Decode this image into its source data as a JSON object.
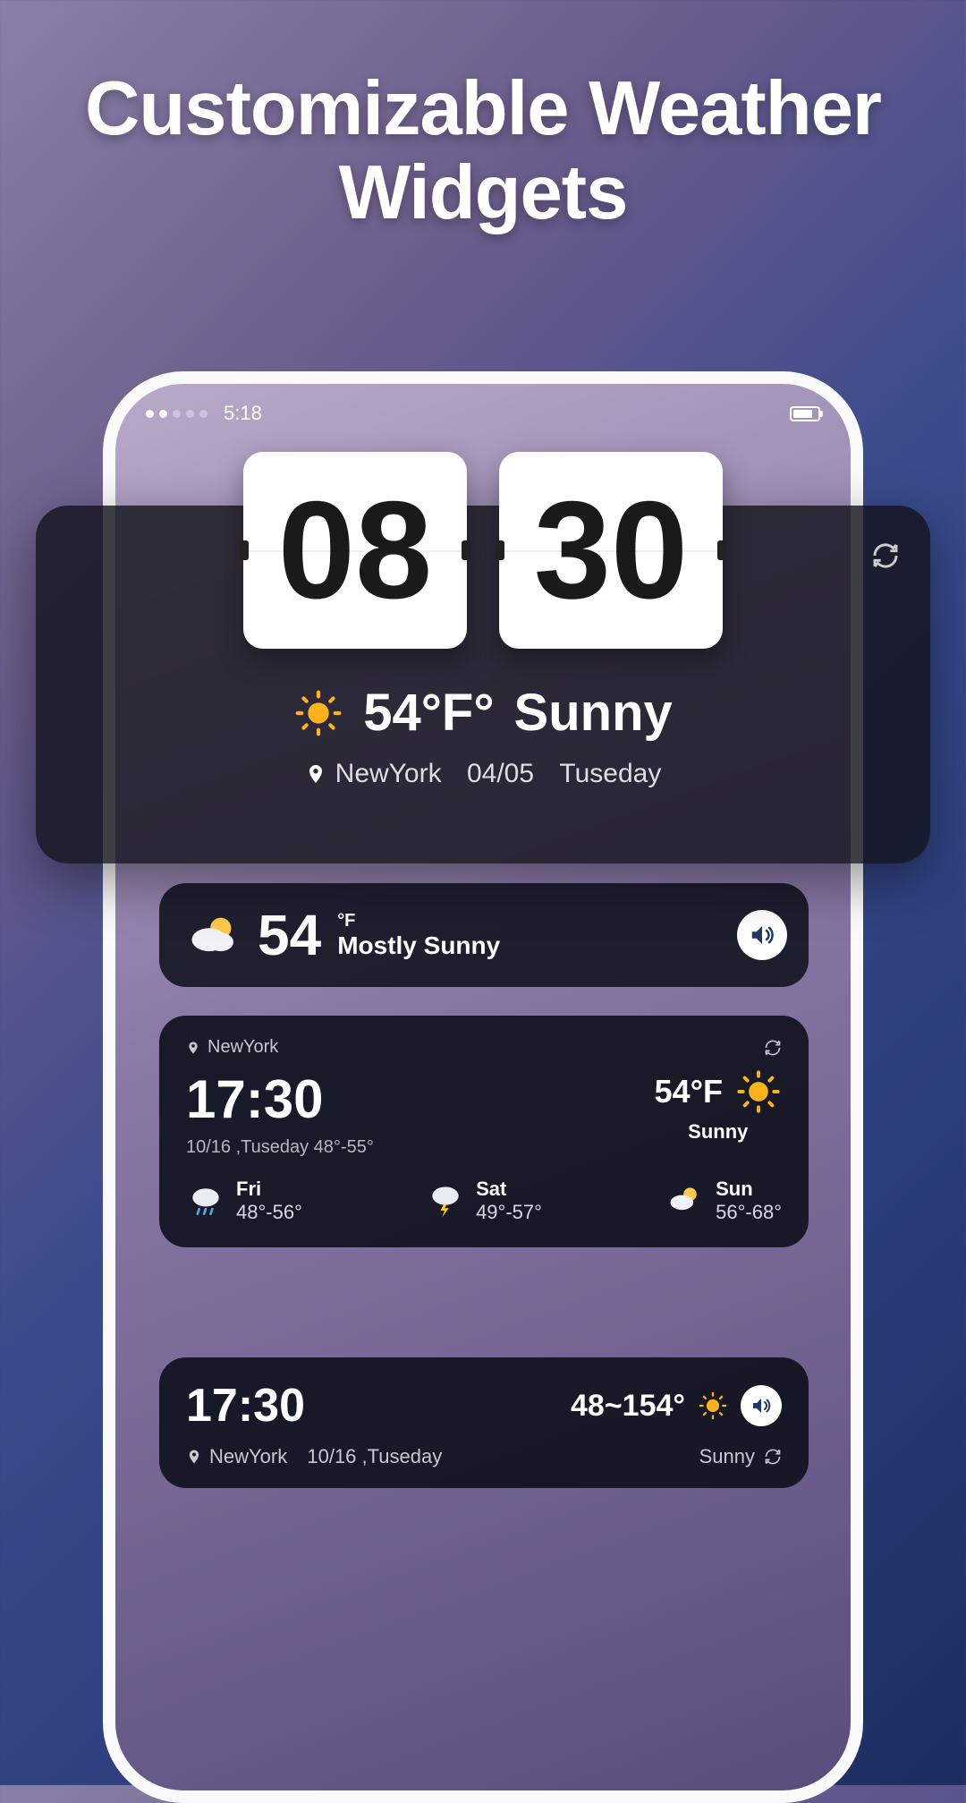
{
  "hero": {
    "title_line1": "Customizable Weather",
    "title_line2": "Widgets"
  },
  "statusbar": {
    "time": "5:18"
  },
  "flip_widget": {
    "hour": "08",
    "minute": "30",
    "temp": "54°F°",
    "condition": "Sunny",
    "location": "NewYork",
    "date": "04/05",
    "weekday": "Tuseday"
  },
  "compact_widget": {
    "temp": "54",
    "unit": "°F",
    "condition": "Mostly Sunny"
  },
  "detail_widget": {
    "location": "NewYork",
    "time": "17:30",
    "date_line": "10/16 ,Tuseday 48°-55°",
    "temp": "54°F",
    "condition": "Sunny",
    "forecast": [
      {
        "day": "Fri",
        "range": "48°-56°",
        "icon": "rain"
      },
      {
        "day": "Sat",
        "range": "49°-57°",
        "icon": "storm"
      },
      {
        "day": "Sun",
        "range": "56°-68°",
        "icon": "partly"
      }
    ]
  },
  "row_widget": {
    "time": "17:30",
    "range": "48~154°",
    "location": "NewYork",
    "date": "10/16 ,Tuseday",
    "condition": "Sunny"
  }
}
